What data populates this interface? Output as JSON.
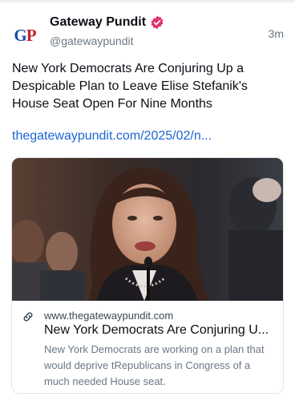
{
  "post": {
    "author_name": "Gateway Pundit",
    "author_handle": "@gatewaypundit",
    "time_ago": "3m",
    "text": "New York Democrats Are Conjuring Up a Despicable Plan to Leave Elise Stefanik's House Seat Open For Nine Months",
    "link": "thegatewaypundit.com/2025/02/n..."
  },
  "avatar": {
    "logo_text_g": "G",
    "logo_text_p": "P"
  },
  "card": {
    "domain": "www.thegatewaypundit.com",
    "title": "New York Democrats Are Conjuring U...",
    "description": "New York Democrats are working on a plan that would deprive tRepublicans in Congress of a much needed House seat."
  },
  "colors": {
    "link": "#1c66d4",
    "verified": "#e1306c",
    "muted": "#6b7785"
  },
  "icons": {
    "verified": "verified-badge-icon",
    "link": "link-icon"
  }
}
